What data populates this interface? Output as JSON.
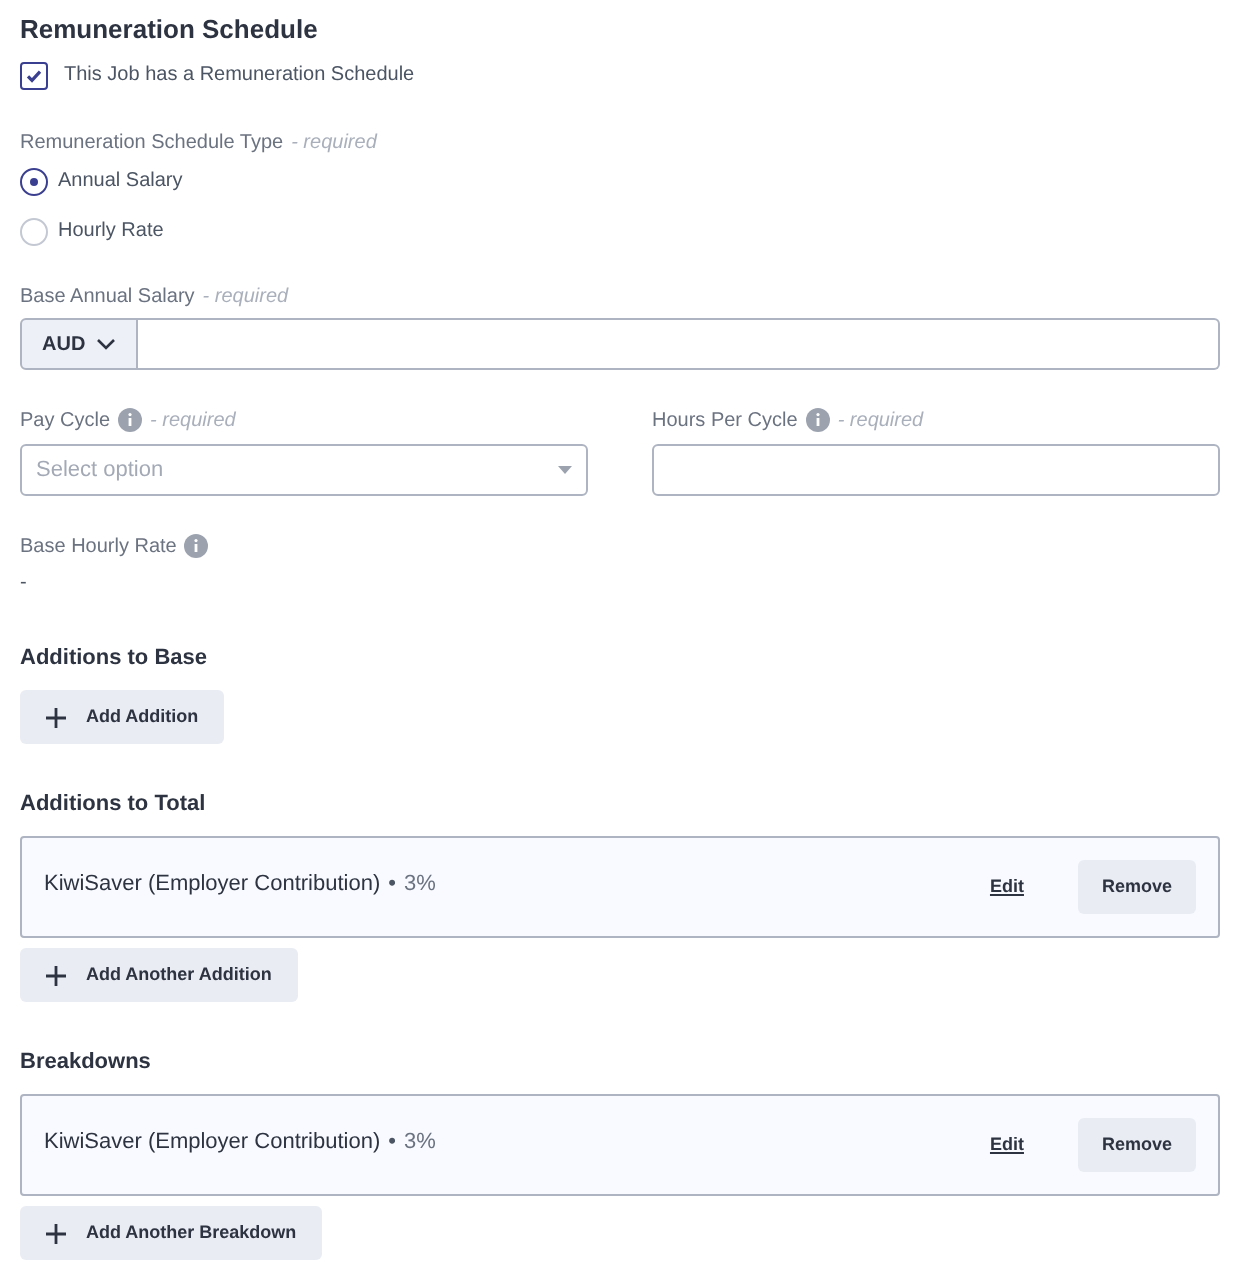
{
  "title": "Remuneration Schedule",
  "has_schedule": {
    "label": "This Job has a Remuneration Schedule",
    "checked": true
  },
  "schedule_type": {
    "label": "Remuneration Schedule Type",
    "required": "- required",
    "options": [
      {
        "label": "Annual Salary",
        "selected": true
      },
      {
        "label": "Hourly Rate",
        "selected": false
      }
    ]
  },
  "base_salary": {
    "label": "Base Annual Salary",
    "required": "- required",
    "currency": "AUD"
  },
  "pay_cycle": {
    "label": "Pay Cycle",
    "required": "- required",
    "placeholder": "Select option"
  },
  "hours_per_cycle": {
    "label": "Hours Per Cycle",
    "required": "- required"
  },
  "base_hourly_rate": {
    "label": "Base Hourly Rate",
    "value": "-"
  },
  "sections": [
    {
      "heading": "Additions to Base",
      "add_button": "Add Addition"
    },
    {
      "heading": "Additions to Total",
      "items": [
        {
          "name": "KiwiSaver (Employer Contribution)",
          "separator": "•",
          "value": "3%",
          "edit": "Edit",
          "remove": "Remove"
        }
      ],
      "add_button": "Add Another Addition"
    },
    {
      "heading": "Breakdowns",
      "items": [
        {
          "name": "KiwiSaver (Employer Contribution)",
          "separator": "•",
          "value": "3%",
          "edit": "Edit",
          "remove": "Remove"
        }
      ],
      "add_button": "Add Another Breakdown"
    }
  ]
}
